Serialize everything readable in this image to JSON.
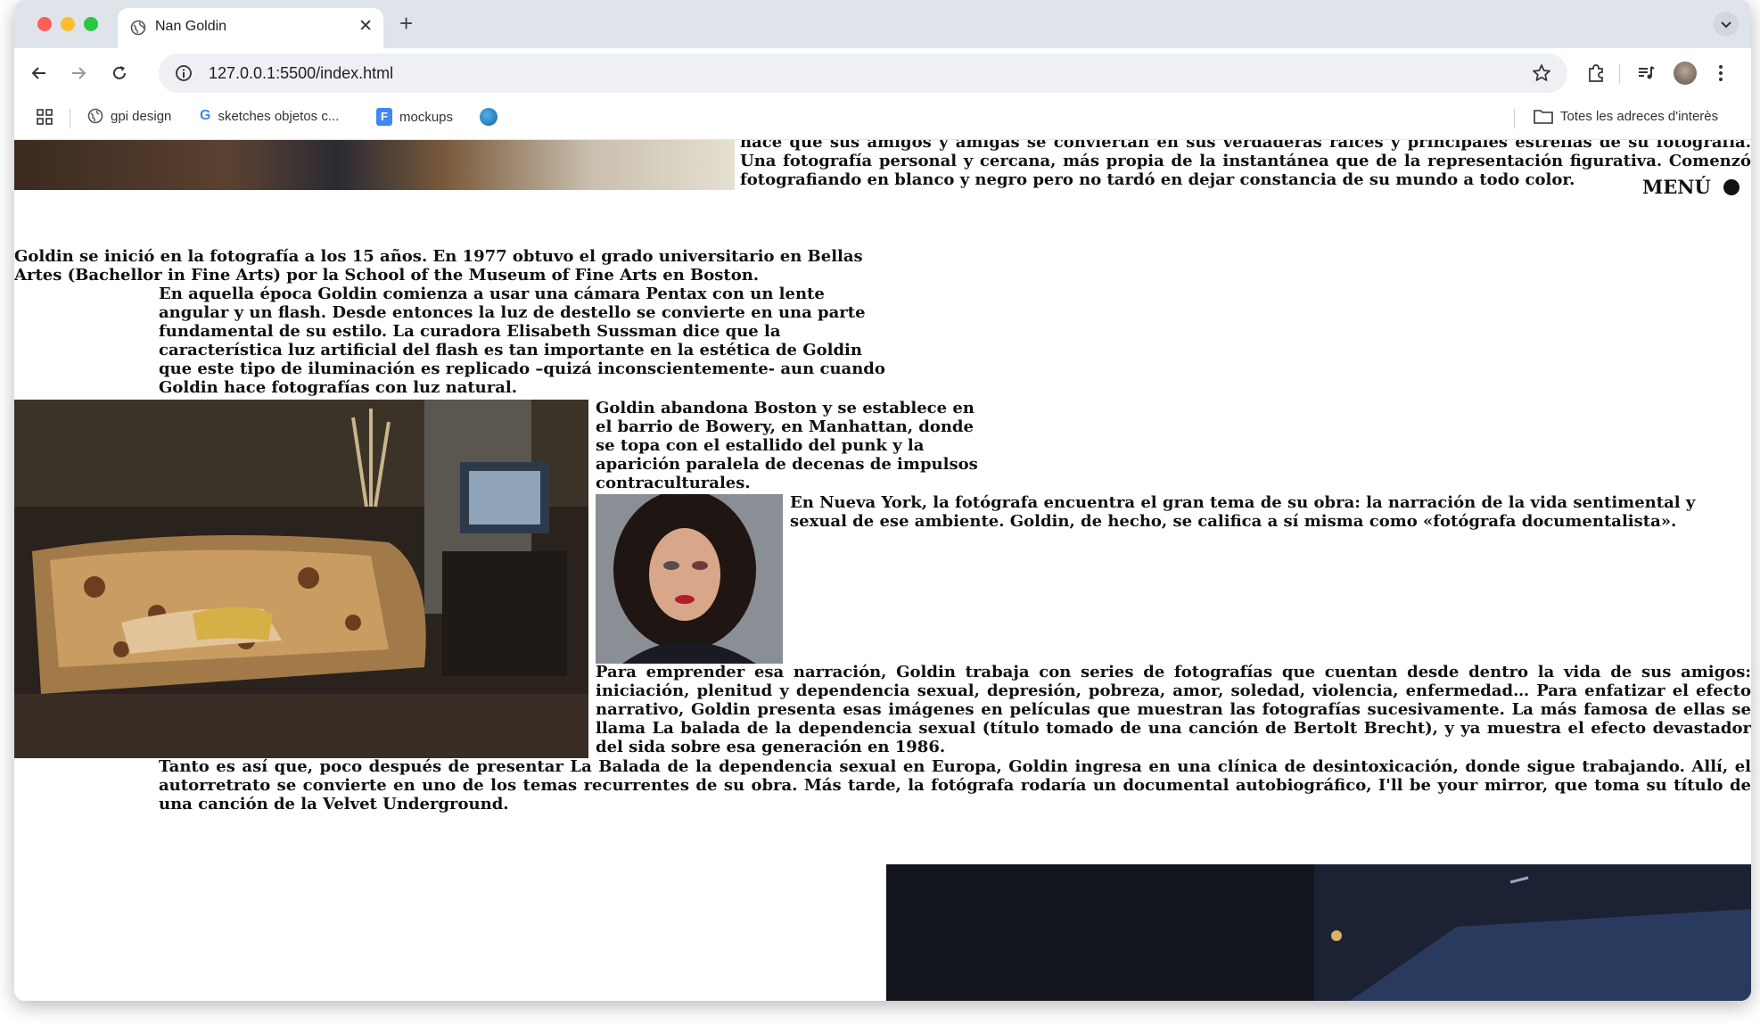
{
  "browser": {
    "tab_title": "Nan Goldin",
    "url": "127.0.0.1:5500/index.html",
    "bookmarks": [
      {
        "label": "gpi design",
        "icon": "globe-icon"
      },
      {
        "label": "sketches objetos c...",
        "icon": "google-icon"
      },
      {
        "label": "mockups",
        "icon": "docs-icon"
      }
    ],
    "all_bookmarks_label": "Totes les adreces d'interès"
  },
  "page": {
    "menu_label": "MENÚ",
    "top_paragraph": "hace que sus amigos y amigas se conviertan en sus verdaderas raíces y principales estrellas de su fotografía. Una fotografía personal y cercana, más propia de la instantánea que de la representación figurativa. Comenzó fotografiando en blanco y negro pero no tardó en dejar constancia de su mundo a todo color.",
    "p1": "Goldin se inició en la fotografía a los 15 años. En 1977 obtuvo el grado universitario en Bellas Artes (Bachellor in Fine Arts) por la School of the Museum of Fine Arts en Boston.",
    "p2": "En aquella época Goldin comienza a usar una cámara Pentax con un lente angular y un flash. Desde entonces la luz de destello se convierte en una parte fundamental de su estilo. La curadora Elisabeth Sussman dice que la característica luz artificial del flash es tan importante en la estética de Goldin que este tipo de iluminación es replicado –quizá inconscientemente- aun cuando Goldin hace fotografías con luz natural.",
    "p3": "Goldin abandona Boston y se establece en el barrio de Bowery, en Manhattan, donde se topa con el estallido del punk y la aparición paralela de decenas de impulsos contraculturales.",
    "p4": "En Nueva York, la fotógrafa encuentra el gran tema de su obra: la narración de la vida sentimental y sexual de ese ambiente. Goldin, de hecho, se califica a sí misma como «fotógrafa documentalista».",
    "p5": "Para emprender esa narración, Goldin trabaja con series de fotografías que cuentan desde dentro la vida de sus amigos: iniciación, plenitud y dependencia sexual, depresión, pobreza, amor, soledad, violencia, enfermedad… Para enfatizar el efecto narrativo, Goldin presenta esas imágenes en películas que muestran las fotografías sucesivamente. La más famosa de ellas se llama La balada de la dependencia sexual (título tomado de una canción de Bertolt Brecht), y ya muestra el efecto devastador del sida sobre esa generación en 1986.",
    "p6": "Tanto es así que, poco después de presentar La Balada de la dependencia sexual en Europa, Goldin ingresa en una clínica de desintoxicación, donde sigue trabajando. Allí, el autorretrato se convierte en uno de los temas recurrentes de su obra. Más tarde, la fotógrafa rodaría un documental autobiográfico, I'll be your mirror, que toma su título de una canción de la Velvet Underground."
  }
}
